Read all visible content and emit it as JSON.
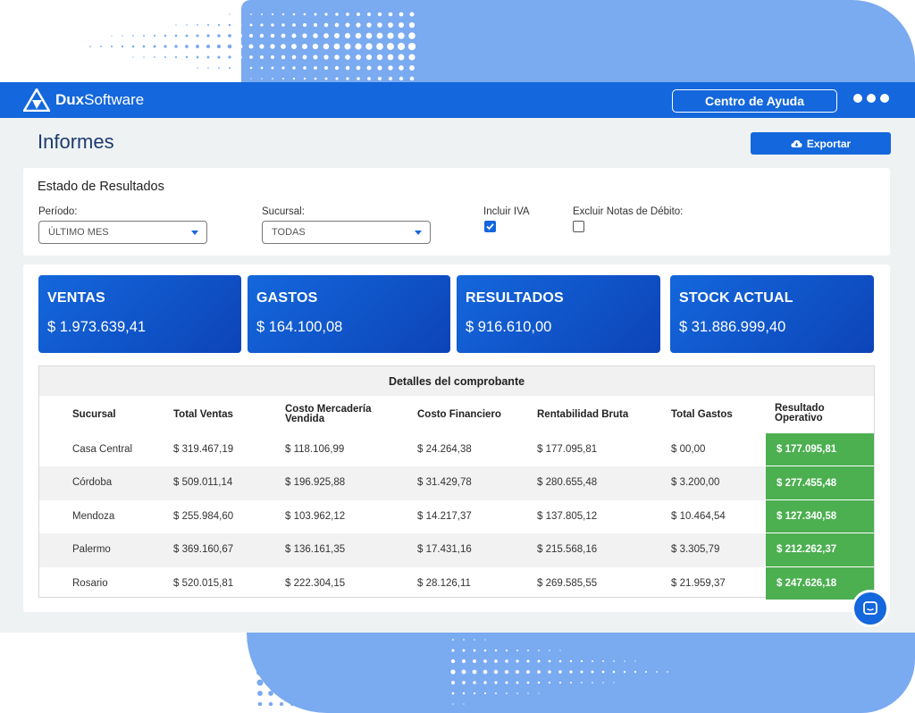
{
  "header": {
    "brand_bold": "Dux",
    "brand_light": "Software",
    "help_label": "Centro de Ayuda",
    "menu_icon": "more-dots-icon"
  },
  "page": {
    "title": "Informes",
    "export_label": "Exportar",
    "export_icon": "cloud-download-icon"
  },
  "filters": {
    "title": "Estado de Resultados",
    "period_label": "Período:",
    "period_value": "ÚLTIMO MES",
    "branch_label": "Sucursal:",
    "branch_value": "TODAS",
    "include_iva_label": "Incluir IVA",
    "include_iva_checked": true,
    "exclude_debit_label": "Excluir Notas de Débito:",
    "exclude_debit_checked": false
  },
  "kpis": [
    {
      "label": "VENTAS",
      "value": "$ 1.973.639,41"
    },
    {
      "label": "GASTOS",
      "value": "$ 164.100,08"
    },
    {
      "label": "RESULTADOS",
      "value": "$ 916.610,00"
    },
    {
      "label": "STOCK ACTUAL",
      "value": "$ 31.886.999,40"
    }
  ],
  "table": {
    "caption": "Detalles del comprobante",
    "columns": [
      "Sucursal",
      "Total Ventas",
      "Costo Mercadería Vendida",
      "Costo Financiero",
      "Rentabilidad Bruta",
      "Total Gastos",
      "Resultado Operativo"
    ],
    "rows": [
      {
        "sucursal": "Casa Central",
        "ventas": "$ 319.467,19",
        "cmv": "$ 118.106,99",
        "financiero": "$ 24.264,38",
        "rentabilidad": "$ 177.095,81",
        "gastos": "$ 00,00",
        "resultado": "$ 177.095,81"
      },
      {
        "sucursal": "Córdoba",
        "ventas": "$ 509.011,14",
        "cmv": "$ 196.925,88",
        "financiero": "$ 31.429,78",
        "rentabilidad": "$ 280.655,48",
        "gastos": "$ 3.200,00",
        "resultado": "$ 277.455,48"
      },
      {
        "sucursal": "Mendoza",
        "ventas": "$ 255.984,60",
        "cmv": "$ 103.962,12",
        "financiero": "$ 14.217,37",
        "rentabilidad": "$ 137.805,12",
        "gastos": "$ 10.464,54",
        "resultado": "$ 127.340,58"
      },
      {
        "sucursal": "Palermo",
        "ventas": "$ 369.160,67",
        "cmv": "$ 136.161,35",
        "financiero": "$ 17.431,16",
        "rentabilidad": "$ 215.568,16",
        "gastos": "$ 3.305,79",
        "resultado": "$ 212.262,37"
      },
      {
        "sucursal": "Rosario",
        "ventas": "$ 520.015,81",
        "cmv": "$ 222.304,15",
        "financiero": "$ 28.126,11",
        "rentabilidad": "$ 269.585,55",
        "gastos": "$ 21.959,37",
        "resultado": "$ 247.626,18"
      }
    ]
  },
  "colors": {
    "primary": "#1467dc",
    "result_green": "#4caf50",
    "background_accent": "#7aaaf0"
  },
  "chat_icon": "chat-bubble-icon"
}
